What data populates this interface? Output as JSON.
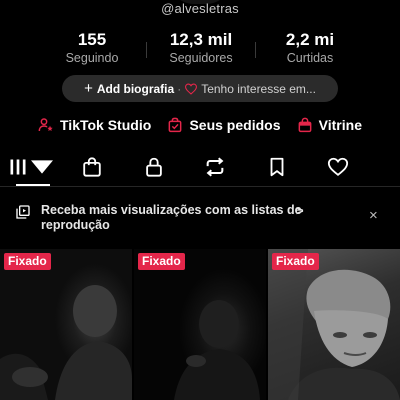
{
  "profile": {
    "username": "@alvesletras"
  },
  "stats": [
    {
      "value": "155",
      "label": "Seguindo"
    },
    {
      "value": "12,3 mil",
      "label": "Seguidores"
    },
    {
      "value": "2,2 mi",
      "label": "Curtidas"
    }
  ],
  "bio": {
    "add_label": "Add biografia",
    "separator": "·",
    "interest_label": "Tenho interesse em..."
  },
  "quick_links": [
    {
      "label": "TikTok Studio",
      "icon": "person-star-icon"
    },
    {
      "label": "Seus pedidos",
      "icon": "order-bag-icon"
    },
    {
      "label": "Vitrine",
      "icon": "shop-bag-icon"
    }
  ],
  "tabs": [
    {
      "name": "videos",
      "icon": "grid-icon",
      "active": true
    },
    {
      "name": "shop",
      "icon": "shopping-bag-icon"
    },
    {
      "name": "private",
      "icon": "lock-icon"
    },
    {
      "name": "reposts",
      "icon": "repost-icon"
    },
    {
      "name": "favorites",
      "icon": "bookmark-icon"
    },
    {
      "name": "liked",
      "icon": "heart-icon"
    }
  ],
  "banner": {
    "text": "Receba mais visualizações com as listas de reprodução",
    "arrow": ">",
    "close": "×"
  },
  "videos": [
    {
      "badge": "Fixado"
    },
    {
      "badge": "Fixado"
    },
    {
      "badge": "Fixado"
    }
  ],
  "colors": {
    "accent_red": "#e4264a",
    "background": "#000000",
    "pill_bg": "#2b2b2b"
  }
}
